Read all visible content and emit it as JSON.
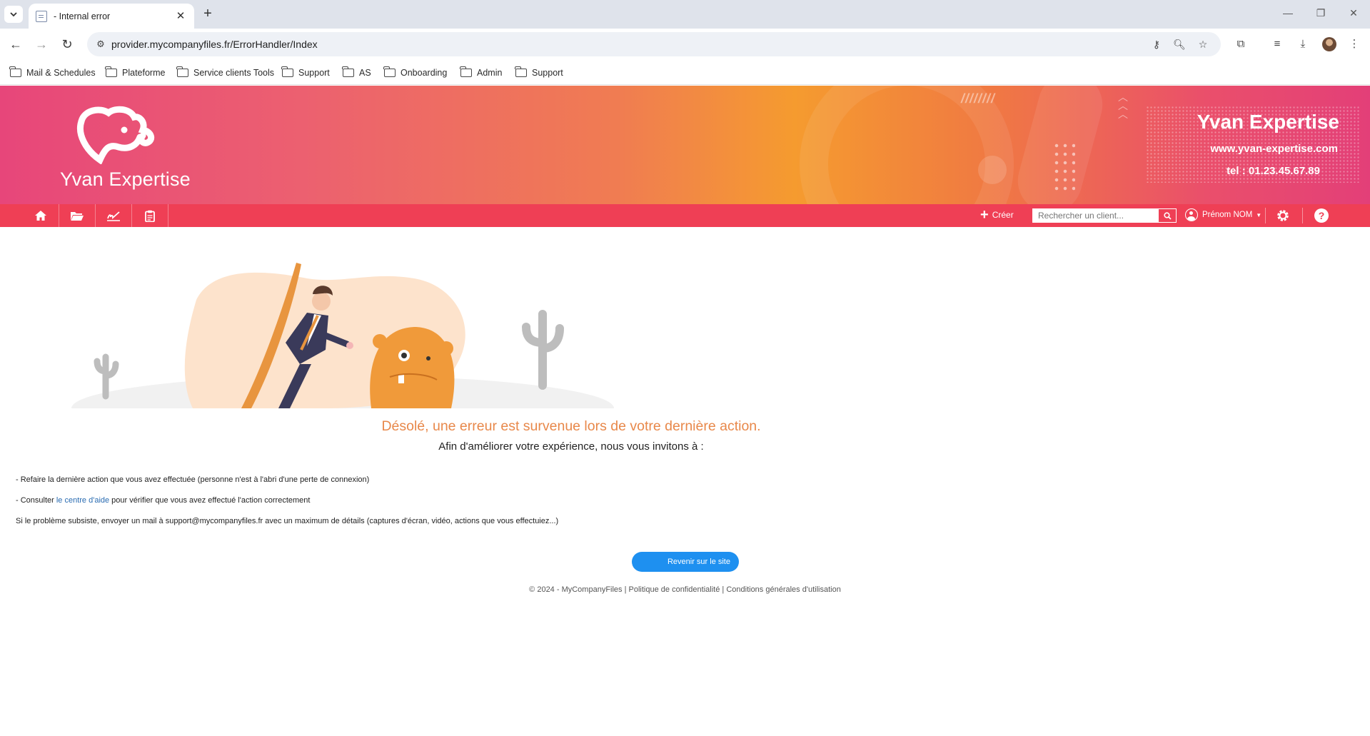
{
  "browser": {
    "tab_title": "- Internal error",
    "url": "provider.mycompanyfiles.fr/ErrorHandler/Index",
    "bookmarks": [
      {
        "label": "Mail & Schedules"
      },
      {
        "label": "Plateforme"
      },
      {
        "label": "Service clients Tools"
      },
      {
        "label": "Support"
      },
      {
        "label": "AS"
      },
      {
        "label": "Onboarding"
      },
      {
        "label": "Admin"
      },
      {
        "label": "Support"
      }
    ]
  },
  "header": {
    "logo_text": "Yvan Expertise",
    "brand_title": "Yvan Expertise",
    "brand_url": "www.yvan-expertise.com",
    "brand_tel": "tel : 01.23.45.67.89",
    "decoration": "////////"
  },
  "navbar": {
    "create_label": "Créer",
    "search_placeholder": "Rechercher un client...",
    "user_name": "Prénom NOM",
    "help_glyph": "?",
    "accent": "#ef3f55"
  },
  "content": {
    "error_title": "Désolé, une erreur est survenue lors de votre dernière action.",
    "error_subtitle": "Afin d'améliorer votre expérience, nous vous invitons à :",
    "line1": "- Refaire la dernière action que vous avez effectuée (personne n'est à l'abri d'une perte de connexion)",
    "line2_prefix": "- Consulter ",
    "line2_link": "le centre d'aide",
    "line2_suffix": " pour vérifier que vous avez effectué l'action correctement",
    "line3": "Si le problème subsiste, envoyer un mail à support@mycompanyfiles.fr avec un maximum de détails (captures d'écran, vidéo, actions que vous effectuiez...)",
    "back_button": "Revenir sur le site",
    "title_color": "#e8884a",
    "button_color": "#1e90f0"
  },
  "footer": {
    "copyright": "© 2024 - MyCompanyFiles",
    "sep": " | ",
    "privacy": "Politique de confidentialité",
    "terms": "Conditions générales d'utilisation"
  }
}
